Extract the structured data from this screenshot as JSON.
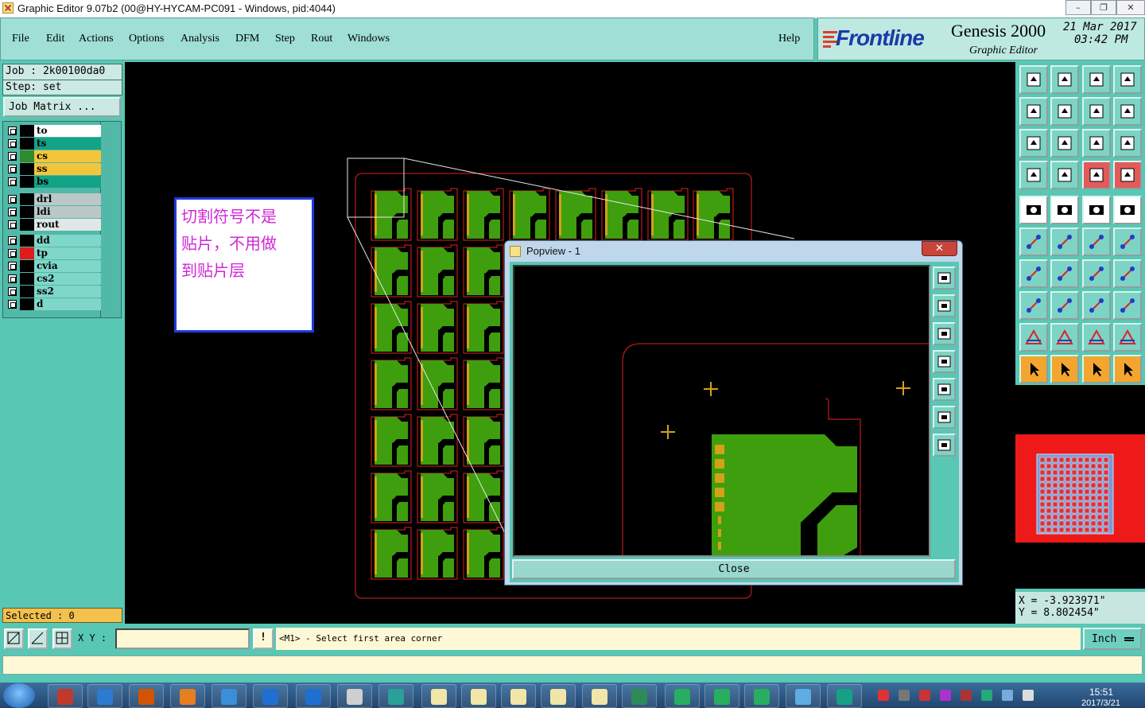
{
  "window": {
    "title": "Graphic Editor 9.07b2 (00@HY-HYCAM-PC091 - Windows, pid:4044)",
    "minimize": "–",
    "maximize": "❐",
    "close": "✕"
  },
  "menu": {
    "items": [
      {
        "label": "File"
      },
      {
        "label": "Edit"
      },
      {
        "label": "Actions"
      },
      {
        "label": "Options"
      },
      {
        "label": "Analysis"
      },
      {
        "label": "DFM"
      },
      {
        "label": "Step"
      },
      {
        "label": "Rout"
      },
      {
        "label": "Windows"
      }
    ],
    "help": "Help"
  },
  "brand": {
    "logo": "Frontline",
    "product": "Genesis 2000",
    "subtitle": "Graphic Editor",
    "date": "21 Mar 2017",
    "time": "03:42 PM"
  },
  "job": {
    "job_label": "Job : 2k00100da0",
    "step_label": "Step: set",
    "matrix_button": "Job Matrix ..."
  },
  "layers": [
    {
      "name": "to",
      "color": "#ffffff",
      "swatch": "#000000"
    },
    {
      "name": "ts",
      "color": "#13a386",
      "swatch": "#000000"
    },
    {
      "name": "cs",
      "color": "#f3c53a",
      "swatch": "#2e8b2e"
    },
    {
      "name": "ss",
      "color": "#f3c53a",
      "swatch": "#000000"
    },
    {
      "name": "bs",
      "color": "#13a386",
      "swatch": "#000000"
    },
    {
      "name": "drl",
      "color": "#bcc7c7",
      "swatch": "#000000"
    },
    {
      "name": "ldi",
      "color": "#bcc7c7",
      "swatch": "#000000"
    },
    {
      "name": "rout",
      "color": "#e1e6e6",
      "swatch": "#000000"
    },
    {
      "name": "dd",
      "color": "#7fd7c9",
      "swatch": "#000000"
    },
    {
      "name": "tp",
      "color": "#7fd7c9",
      "swatch": "#e01b1b"
    },
    {
      "name": "cvia",
      "color": "#7fd7c9",
      "swatch": "#000000"
    },
    {
      "name": "cs2",
      "color": "#7fd7c9",
      "swatch": "#000000"
    },
    {
      "name": "ss2",
      "color": "#7fd7c9",
      "swatch": "#000000"
    },
    {
      "name": "d",
      "color": "#7fd7c9",
      "swatch": "#000000"
    }
  ],
  "selected": "Selected : 0",
  "note": {
    "line1": "切割符号不是",
    "line2": "贴片，不用做",
    "line3": "到贴片层"
  },
  "popup": {
    "title": "Popview - 1",
    "close_label": "Close",
    "close_x": "✕"
  },
  "coords": {
    "x": "X = -3.923971\"",
    "y": "Y = 8.802454\""
  },
  "command": {
    "xy_label": "X Y :",
    "xy_value": "",
    "bang": "!",
    "prompt": "<M1> - Select first area corner",
    "units": "Inch"
  },
  "taskbar": {
    "clock": "15:51",
    "date": "2017/3/21"
  },
  "colors": {
    "accent": "#58c7b4",
    "board_green": "#3e9e0e",
    "outline_red": "#e02020",
    "pad_yellow": "#d4a017"
  }
}
